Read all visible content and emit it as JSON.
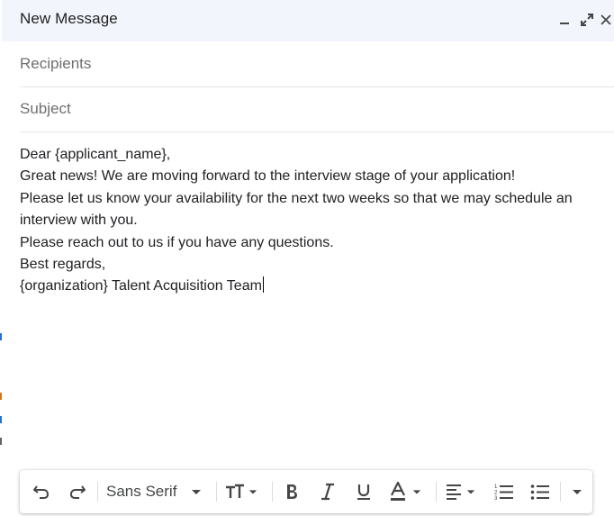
{
  "window": {
    "title": "New Message",
    "minimize_label": "Minimize",
    "popout_label": "Full screen",
    "close_label": "Close"
  },
  "fields": {
    "recipients_placeholder": "Recipients",
    "subject_placeholder": "Subject"
  },
  "body": {
    "lines": [
      "Dear {applicant_name},",
      "Great news! We are moving forward to the interview stage of your application!",
      "Please let us know your availability for the next two weeks so that we may schedule an",
      "interview with you.",
      "Please reach out to us if you have any questions.",
      "Best regards,",
      "{organization} Talent Acquisition Team"
    ]
  },
  "toolbar": {
    "font_family": "Sans Serif",
    "icons": [
      "undo-icon",
      "redo-icon",
      "font-dropdown-icon",
      "text-size-icon",
      "bold-icon",
      "italic-icon",
      "underline-icon",
      "text-color-icon",
      "align-icon",
      "numbered-list-icon",
      "bulleted-list-icon",
      "more-formatting-icon"
    ]
  },
  "colors": {
    "header_bg": "#f2f6fc",
    "text": "#202124",
    "icon": "#444746",
    "placeholder": "#6f6f6f"
  }
}
